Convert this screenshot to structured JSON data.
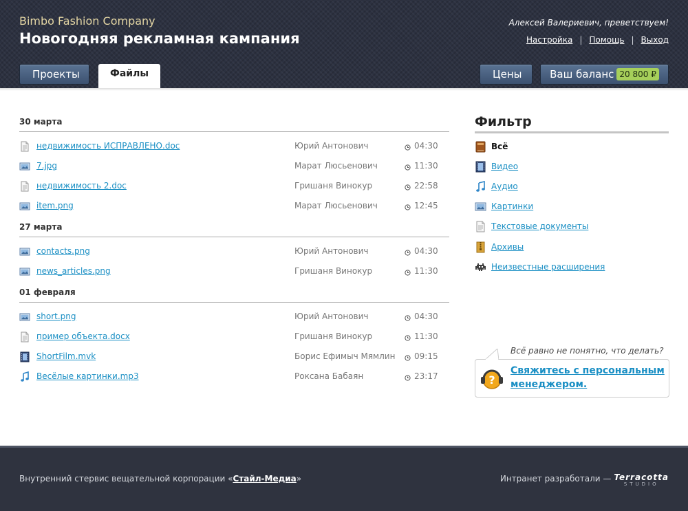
{
  "header": {
    "company": "Bimbo Fashion Company",
    "campaign": "Новогодняя рекламная кампания",
    "greeting": "Алексей Валериевич, преветствуем!",
    "links": {
      "settings": "Настройка",
      "help": "Помощь",
      "logout": "Выход",
      "separator": "|"
    },
    "nav": {
      "projects": "Проекты",
      "files": "Файлы",
      "prices": "Цены",
      "balance_label": "Ваш баланс",
      "balance_value": "20 800 ₽"
    }
  },
  "files": {
    "groups": [
      {
        "date": "30 марта",
        "items": [
          {
            "name": "недвижимость ИСПРАВЛЕНО.doc",
            "type": "doc",
            "author": "Юрий Антонович",
            "time": "04:30"
          },
          {
            "name": "7.jpg",
            "type": "image",
            "author": "Марат Люсьенович",
            "time": "11:30"
          },
          {
            "name": "недвижимость 2.doc ",
            "type": "doc",
            "author": "Гришаня Винокур",
            "time": "22:58"
          },
          {
            "name": "item.png",
            "type": "image",
            "author": "Марат Люсьенович",
            "time": "12:45"
          }
        ]
      },
      {
        "date": "27 марта",
        "items": [
          {
            "name": "contacts.png",
            "type": "image",
            "author": "Юрий Антонович",
            "time": "04:30"
          },
          {
            "name": "news_articles.png",
            "type": "image",
            "author": "Гришаня Винокур",
            "time": "11:30"
          }
        ]
      },
      {
        "date": "01 февраля",
        "items": [
          {
            "name": "short.png",
            "type": "image",
            "author": "Юрий Антонович",
            "time": "04:30"
          },
          {
            "name": "пример объекта.docx ",
            "type": "doc",
            "author": "Гришаня Винокур",
            "time": "11:30"
          },
          {
            "name": "ShortFilm.mvk",
            "type": "video",
            "author": "Борис Ефимыч Мямлин",
            "time": "09:15"
          },
          {
            "name": "Весёлые картинки.mp3",
            "type": "audio",
            "author": "Роксана Бабаян",
            "time": "23:17"
          }
        ]
      }
    ]
  },
  "filter": {
    "title": "Фильтр",
    "items": [
      {
        "label": "Всё",
        "icon": "book-icon",
        "active": true
      },
      {
        "label": "Видео",
        "icon": "film-icon",
        "active": false
      },
      {
        "label": "Аудио",
        "icon": "music-note-icon",
        "active": false
      },
      {
        "label": "Картинки",
        "icon": "image-icon",
        "active": false
      },
      {
        "label": "Текстовые документы",
        "icon": "document-icon",
        "active": false
      },
      {
        "label": "Архивы",
        "icon": "archive-icon",
        "active": false
      },
      {
        "label": "Неизвестные расширения",
        "icon": "space-invader-icon",
        "active": false
      }
    ]
  },
  "help": {
    "question": "Всё равно не понятно, что делать?",
    "link": "Свяжитесь с персональным менеджером."
  },
  "footer": {
    "left_text": "Внутренний стервис вещательной корпорации «",
    "left_link": "Стайл-Медиа",
    "left_end": "»",
    "right_text": "Интранет разработали —",
    "logo_line1": "Terracotta",
    "logo_line2": "STUDIO"
  },
  "colors": {
    "link": "#1a8fc4",
    "header_bg": "#2c3140",
    "footer_bg": "#2f333f",
    "button": "#4a607f",
    "badge": "#a6cf5a"
  }
}
